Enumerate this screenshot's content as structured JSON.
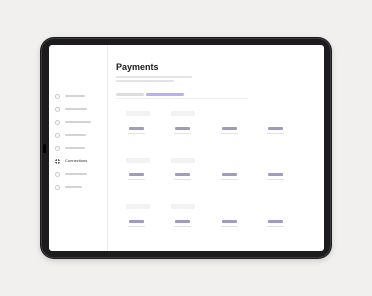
{
  "page": {
    "title": "Payments"
  },
  "sidebar": {
    "items": [
      {
        "icon": "circle-icon",
        "label": ""
      },
      {
        "icon": "home-icon",
        "label": ""
      },
      {
        "icon": "clock-icon",
        "label": ""
      },
      {
        "icon": "send-icon",
        "label": ""
      },
      {
        "icon": "user-icon",
        "label": ""
      },
      {
        "icon": "grid-icon",
        "label": "Connections",
        "active": true
      },
      {
        "icon": "settings-icon",
        "label": ""
      },
      {
        "icon": "help-icon",
        "label": ""
      }
    ]
  },
  "tabs": [
    {
      "label": "",
      "active": false
    },
    {
      "label": "",
      "active": true
    }
  ],
  "colors": {
    "background": "#f1f0ee",
    "device": "#1c1c1e",
    "accent": "#b8b0f0",
    "value": "#9f9bc2"
  }
}
